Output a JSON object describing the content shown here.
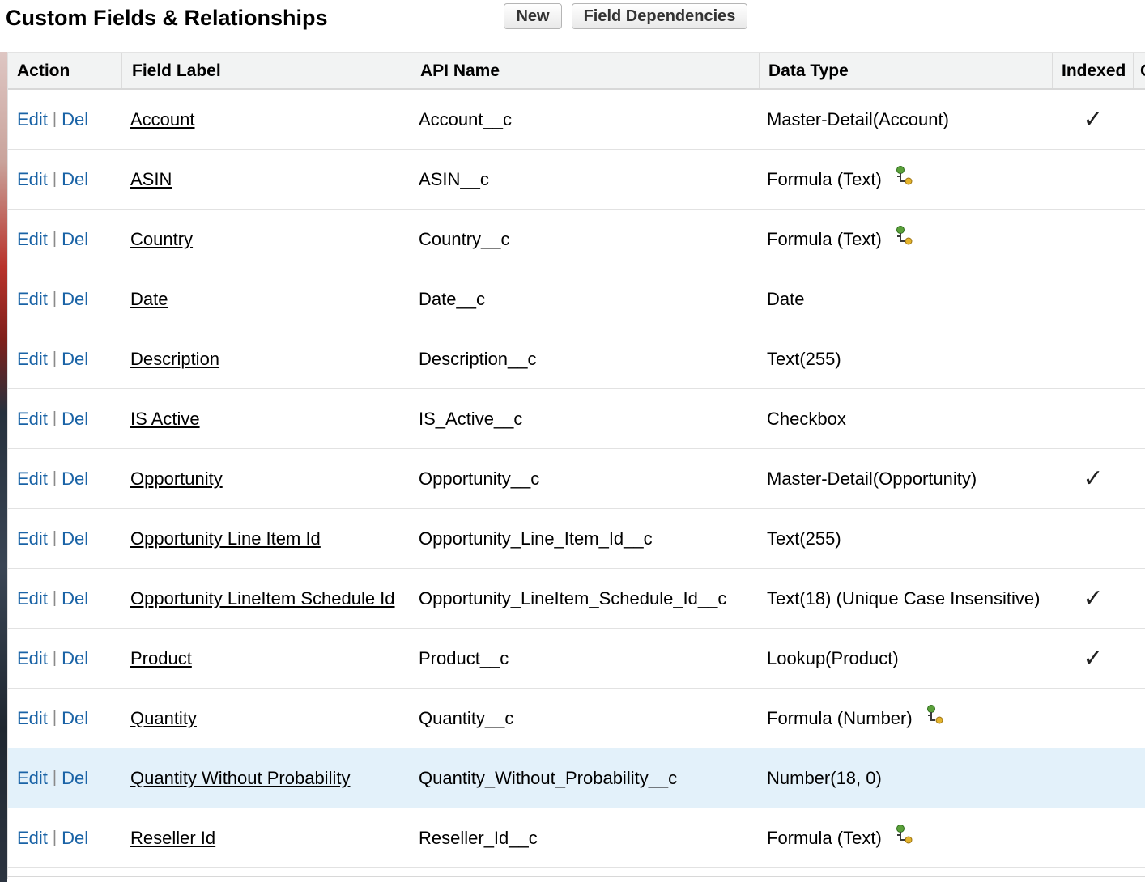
{
  "header": {
    "title": "Custom Fields & Relationships",
    "new_button": "New",
    "dependencies_button": "Field Dependencies"
  },
  "table": {
    "columns": {
      "action": "Action",
      "field_label": "Field Label",
      "api_name": "API Name",
      "data_type": "Data Type",
      "indexed": "Indexed",
      "more": "C"
    },
    "action_edit": "Edit",
    "action_separator": "|",
    "action_del": "Del",
    "rows": [
      {
        "label": "Account",
        "api": "Account__c",
        "type": "Master-Detail(Account)",
        "formula_icon": false,
        "indexed": true,
        "highlighted": false
      },
      {
        "label": "ASIN",
        "api": "ASIN__c",
        "type": "Formula (Text)",
        "formula_icon": true,
        "indexed": false,
        "highlighted": false
      },
      {
        "label": "Country",
        "api": "Country__c",
        "type": "Formula (Text)",
        "formula_icon": true,
        "indexed": false,
        "highlighted": false
      },
      {
        "label": "Date",
        "api": "Date__c",
        "type": "Date",
        "formula_icon": false,
        "indexed": false,
        "highlighted": false
      },
      {
        "label": "Description",
        "api": "Description__c",
        "type": "Text(255)",
        "formula_icon": false,
        "indexed": false,
        "highlighted": false
      },
      {
        "label": "IS Active",
        "api": "IS_Active__c",
        "type": "Checkbox",
        "formula_icon": false,
        "indexed": false,
        "highlighted": false
      },
      {
        "label": "Opportunity",
        "api": "Opportunity__c",
        "type": "Master-Detail(Opportunity)",
        "formula_icon": false,
        "indexed": true,
        "highlighted": false
      },
      {
        "label": "Opportunity Line Item Id",
        "api": "Opportunity_Line_Item_Id__c",
        "type": "Text(255)",
        "formula_icon": false,
        "indexed": false,
        "highlighted": false
      },
      {
        "label": "Opportunity LineItem Schedule Id",
        "api": "Opportunity_LineItem_Schedule_Id__c",
        "type": "Text(18) (Unique Case Insensitive)",
        "formula_icon": false,
        "indexed": true,
        "highlighted": false
      },
      {
        "label": "Product",
        "api": "Product__c",
        "type": "Lookup(Product)",
        "formula_icon": false,
        "indexed": true,
        "highlighted": false
      },
      {
        "label": "Quantity",
        "api": "Quantity__c",
        "type": "Formula (Number)",
        "formula_icon": true,
        "indexed": false,
        "highlighted": false
      },
      {
        "label": "Quantity Without Probability",
        "api": "Quantity_Without_Probability__c",
        "type": "Number(18, 0)",
        "formula_icon": false,
        "indexed": false,
        "highlighted": true
      },
      {
        "label": "Reseller Id",
        "api": "Reseller_Id__c",
        "type": "Formula (Text)",
        "formula_icon": true,
        "indexed": false,
        "highlighted": false
      }
    ]
  },
  "icons": {
    "checkmark": "✓",
    "formula": "formula-icon"
  },
  "colors": {
    "link_blue": "#1a63a6",
    "row_highlight": "#e3f1fa",
    "header_bg": "#f2f3f3"
  }
}
